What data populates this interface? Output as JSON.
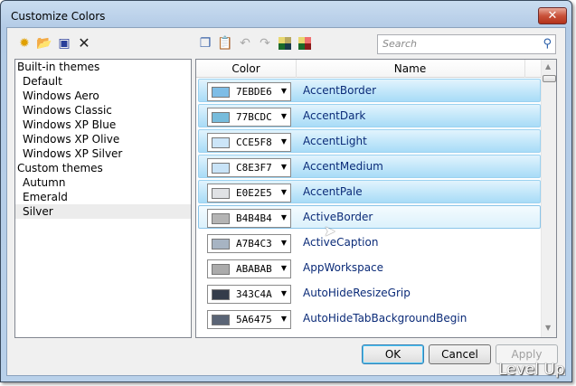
{
  "window": {
    "title": "Customize Colors",
    "close": "✕"
  },
  "toolbar": {
    "search_placeholder": "Search"
  },
  "themes": [
    {
      "label": "Built-in themes",
      "group": true
    },
    {
      "label": "Default"
    },
    {
      "label": "Windows Aero"
    },
    {
      "label": "Windows Classic"
    },
    {
      "label": "Windows XP Blue"
    },
    {
      "label": "Windows XP Olive"
    },
    {
      "label": "Windows XP Silver"
    },
    {
      "label": "Custom themes",
      "group": true
    },
    {
      "label": "Autumn"
    },
    {
      "label": "Emerald"
    },
    {
      "label": "Silver",
      "selected": true
    }
  ],
  "grid": {
    "headers": {
      "color": "Color",
      "name": "Name"
    },
    "rows": [
      {
        "hex": "7EBDE6",
        "color": "#7EBDE6",
        "name": "AccentBorder",
        "state": "hl"
      },
      {
        "hex": "77BCDC",
        "color": "#77BCDC",
        "name": "AccentDark",
        "state": "hl"
      },
      {
        "hex": "CCE5F8",
        "color": "#CCE5F8",
        "name": "AccentLight",
        "state": "hl"
      },
      {
        "hex": "C8E3F7",
        "color": "#C8E3F7",
        "name": "AccentMedium",
        "state": "hl"
      },
      {
        "hex": "E0E2E5",
        "color": "#E0E2E5",
        "name": "AccentPale",
        "state": "hl"
      },
      {
        "hex": "B4B4B4",
        "color": "#B4B4B4",
        "name": "ActiveBorder",
        "state": "hov"
      },
      {
        "hex": "A7B4C3",
        "color": "#A7B4C3",
        "name": "ActiveCaption",
        "state": ""
      },
      {
        "hex": "ABABAB",
        "color": "#ABABAB",
        "name": "AppWorkspace",
        "state": ""
      },
      {
        "hex": "343C4A",
        "color": "#343C4A",
        "name": "AutoHideResizeGrip",
        "state": ""
      },
      {
        "hex": "5A6475",
        "color": "#5A6475",
        "name": "AutoHideTabBackgroundBegin",
        "state": ""
      }
    ]
  },
  "buttons": {
    "ok": "OK",
    "cancel": "Cancel",
    "apply": "Apply"
  },
  "watermark": "Level Up"
}
